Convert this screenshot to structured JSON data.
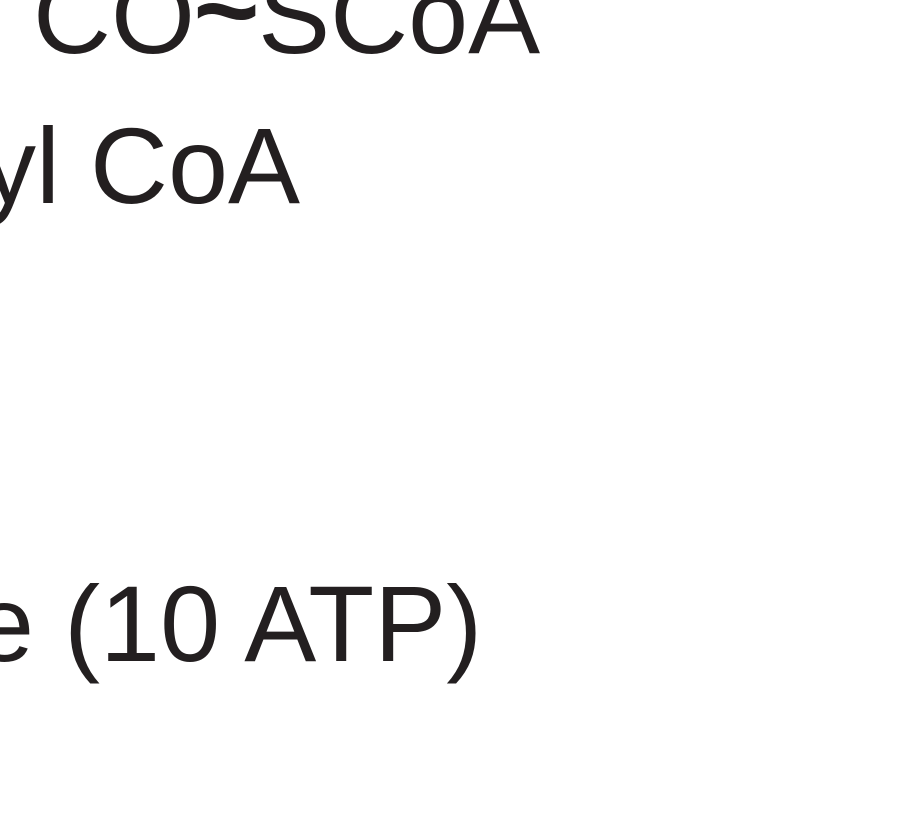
{
  "formula": {
    "prefix": "CO",
    "bond": "~",
    "suffix": "SCoA"
  },
  "label_line_2": "yl CoA",
  "label_line_3": "e (10 ATP)",
  "colors": {
    "text": "#231f20",
    "background": "#ffffff"
  }
}
